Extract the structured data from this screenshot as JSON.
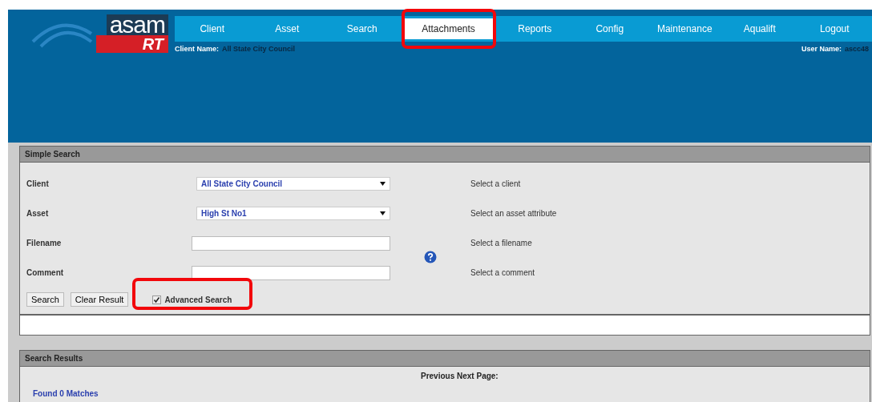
{
  "logo": {
    "word": "asam",
    "badge": "RT"
  },
  "nav": [
    {
      "label": "Client",
      "selected": false,
      "highlighted": false
    },
    {
      "label": "Asset",
      "selected": false,
      "highlighted": false
    },
    {
      "label": "Search",
      "selected": false,
      "highlighted": false
    },
    {
      "label": "Attachments",
      "selected": true,
      "highlighted": true
    },
    {
      "label": "Reports",
      "selected": false,
      "highlighted": false
    },
    {
      "label": "Config",
      "selected": false,
      "highlighted": false
    },
    {
      "label": "Maintenance",
      "selected": false,
      "highlighted": false
    },
    {
      "label": "Aqualift",
      "selected": false,
      "highlighted": false
    },
    {
      "label": "Logout",
      "selected": false,
      "highlighted": false
    }
  ],
  "client_name": {
    "label": "Client Name:",
    "value": "All State City Council"
  },
  "user_name": {
    "label": "User Name:",
    "value": "ascc48"
  },
  "simple_search": {
    "title": "Simple Search",
    "fields": [
      {
        "label": "Client",
        "kind": "select",
        "value": "All State City Council",
        "hint": "Select a client"
      },
      {
        "label": "Asset",
        "kind": "select",
        "value": "High St No1",
        "hint": "Select an asset attribute"
      },
      {
        "label": "Filename",
        "kind": "text",
        "hint": "Select a filename"
      },
      {
        "label": "Comment",
        "kind": "text",
        "hint": "Select a comment"
      }
    ],
    "buttons": [
      "Search",
      "Clear Result"
    ],
    "advanced": {
      "label": "Advanced Search",
      "checked": true,
      "highlighted": true
    }
  },
  "search_results": {
    "title": "Search Results",
    "pager": "Previous  Next  Page:",
    "found": "Found 0  Matches"
  }
}
